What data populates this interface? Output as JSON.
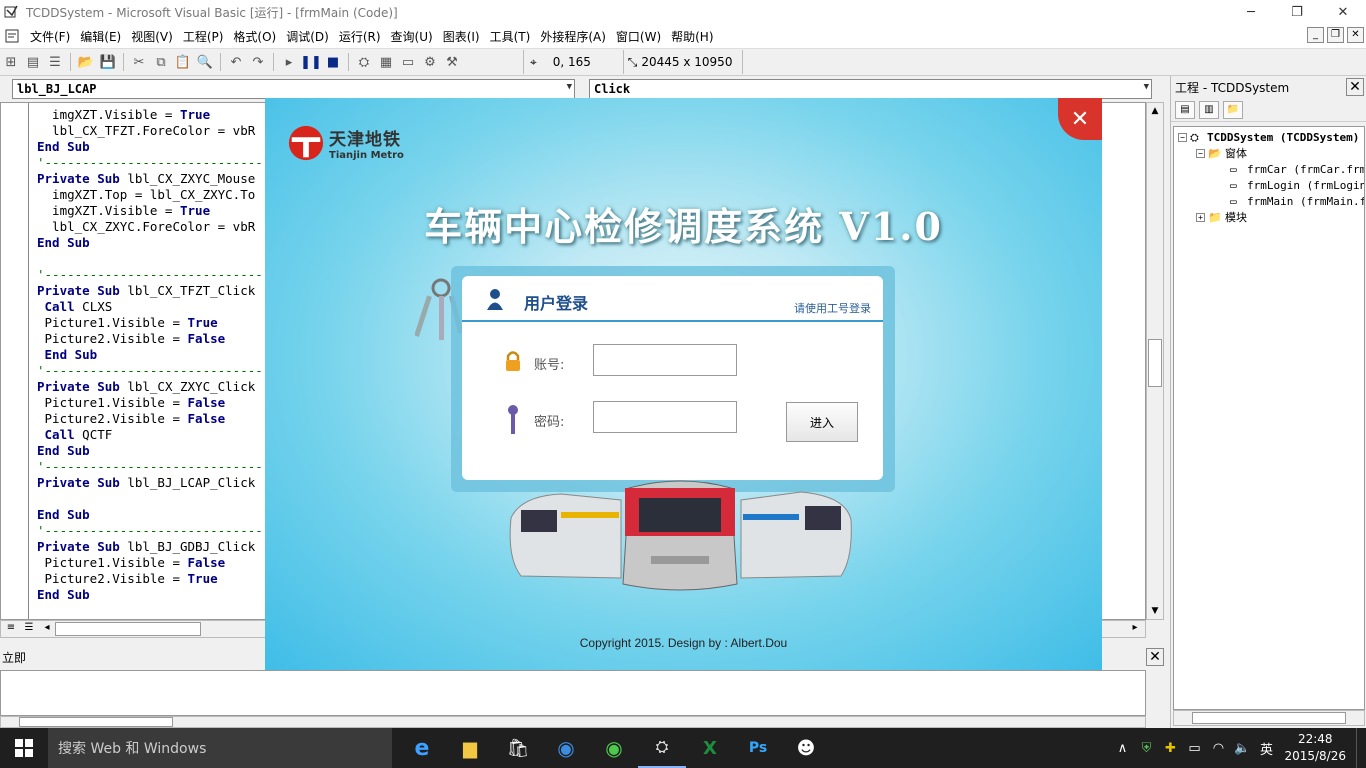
{
  "window": {
    "title": "TCDDSystem - Microsoft Visual Basic [运行] - [frmMain (Code)]"
  },
  "menu": [
    "文件(F)",
    "编辑(E)",
    "视图(V)",
    "工程(P)",
    "格式(O)",
    "调试(D)",
    "运行(R)",
    "查询(U)",
    "图表(I)",
    "工具(T)",
    "外接程序(A)",
    "窗口(W)",
    "帮助(H)"
  ],
  "toolbar": {
    "position": "0, 165",
    "size": "20445 x 10950"
  },
  "code_window": {
    "object_combo": "lbl_BJ_LCAP",
    "proc_combo": "Click",
    "lines": [
      "  imgXZT.Visible = True",
      "  lbl_CX_TFZT.ForeColor = vbR",
      "End Sub",
      "'-----------------------------",
      "Private Sub lbl_CX_ZXYC_Mouse",
      "  imgXZT.Top = lbl_CX_ZXYC.To",
      "  imgXZT.Visible = True",
      "  lbl_CX_ZXYC.ForeColor = vbR",
      "End Sub",
      "",
      "'-----------------------------",
      "Private Sub lbl_CX_TFZT_Click",
      " Call CLXS",
      " Picture1.Visible = True",
      " Picture2.Visible = False",
      " End Sub",
      "'-----------------------------",
      "Private Sub lbl_CX_ZXYC_Click",
      " Picture1.Visible = False",
      " Picture2.Visible = False",
      " Call QCTF",
      "End Sub",
      "'-----------------------------",
      "Private Sub lbl_BJ_LCAP_Click",
      "",
      "End Sub",
      "'-----------------------------",
      "Private Sub lbl_BJ_GDBJ_Click",
      " Picture1.Visible = False",
      " Picture2.Visible = True",
      "End Sub"
    ]
  },
  "immediate": {
    "title": "立即"
  },
  "project": {
    "title": "工程 - TCDDSystem",
    "root": "TCDDSystem (TCDDSystem)",
    "forms_folder": "窗体",
    "forms": [
      "frmCar (frmCar.frm)",
      "frmLogin (frmLogin.frm)",
      "frmMain (frmMain.frm)"
    ],
    "modules_folder": "模块"
  },
  "login": {
    "logo_cn": "天津地铁",
    "logo_en": "Tianjin Metro",
    "system_title": "车辆中心检修调度系统 V1.0",
    "panel_title": "用户登录",
    "hint": "请使用工号登录",
    "account_label": "账号:",
    "account_value": "",
    "password_label": "密码:",
    "password_value": "",
    "enter_label": "进入",
    "copyright": "Copyright  2015.   Design by :  Albert.Dou",
    "close_glyph": "✕"
  },
  "taskbar": {
    "search_placeholder": "搜索 Web 和 Windows",
    "time": "22:48",
    "date": "2015/8/26",
    "ime": "英"
  },
  "colors": {
    "accent_red": "#d9342b",
    "title_blue": "#1e4f8a",
    "keyword": "#000080"
  }
}
